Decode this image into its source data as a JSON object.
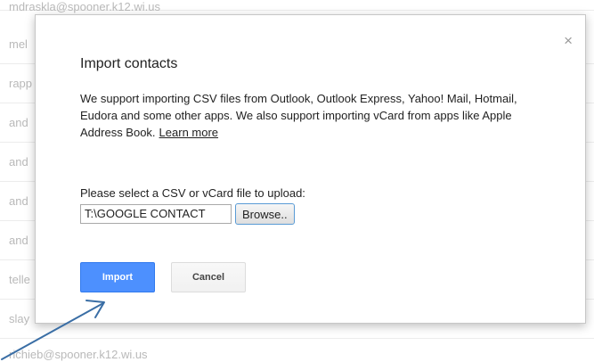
{
  "background_list": {
    "rows": [
      "mdraskla@spooner.k12.wi.us",
      "mel",
      "rapp",
      "and",
      "and",
      "and",
      "and",
      "telle",
      "slay",
      "richieb@spooner.k12.wi.us"
    ]
  },
  "dialog": {
    "close_glyph": "×",
    "title": "Import contacts",
    "description": "We support importing CSV files from Outlook, Outlook Express, Yahoo! Mail, Hotmail, Eudora and some other apps. We also support importing vCard from apps like Apple Address Book.",
    "learn_more": "Learn more",
    "upload_label": "Please select a CSV or vCard file to upload:",
    "file_value": "T:\\GOOGLE CONTACT",
    "browse_label": "Browse..",
    "import_label": "Import",
    "cancel_label": "Cancel"
  },
  "colors": {
    "import_button": "#4d90fe",
    "annotation_arrow": "#3a6ea5"
  }
}
